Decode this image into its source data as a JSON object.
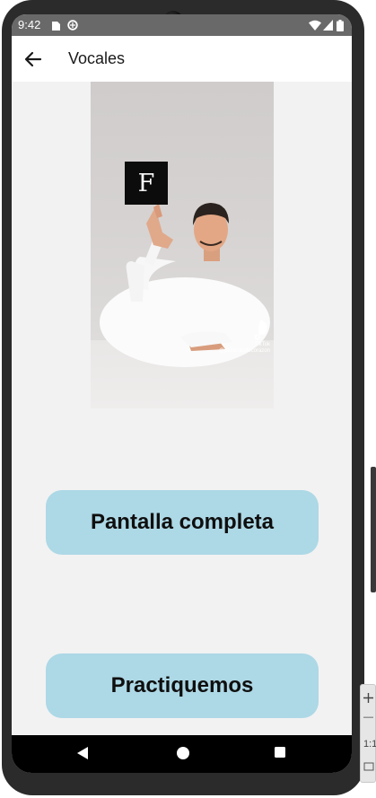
{
  "status_bar": {
    "time": "9:42",
    "icons": [
      "sd-card-icon",
      "data-saver-icon",
      "wifi-icon",
      "signal-icon",
      "battery-icon"
    ]
  },
  "app_bar": {
    "back_icon": "arrow-left-icon",
    "title": "Vocales"
  },
  "video": {
    "letter": "F",
    "watermark_brand": "TikTok",
    "watermark_handle": "@palabrasdecorazon"
  },
  "buttons": {
    "fullscreen_label": "Pantalla completa",
    "practice_label": "Practiquemos"
  },
  "nav_bar": {
    "icons": [
      "back-triangle-icon",
      "home-circle-icon",
      "recents-square-icon"
    ]
  },
  "emulator_toolbar": {
    "zoom_label": "1:1"
  },
  "colors": {
    "button_bg": "#add8e6",
    "screen_bg": "#f2f2f2",
    "status_bar_bg": "#696969",
    "app_bar_bg": "#ffffff"
  }
}
